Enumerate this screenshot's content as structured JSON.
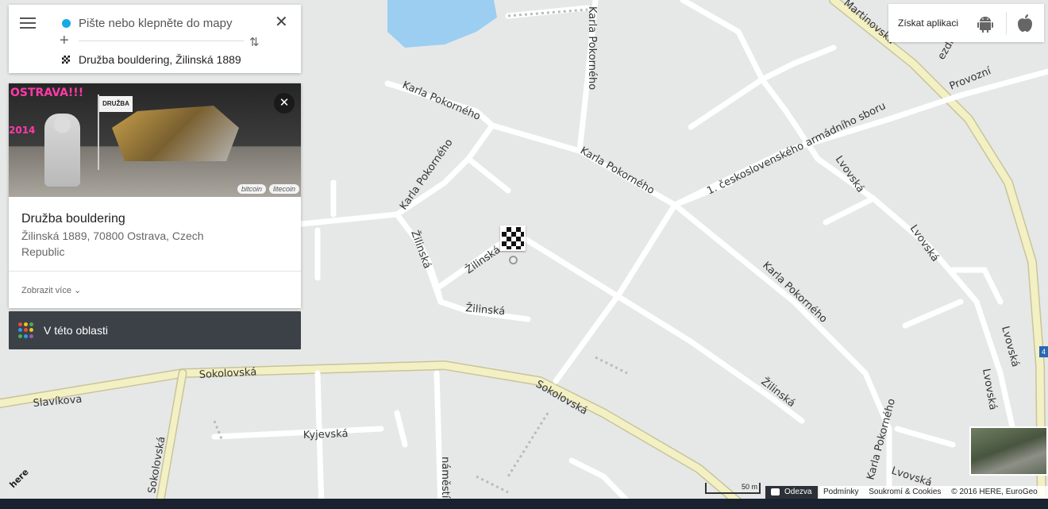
{
  "search": {
    "from_placeholder": "Pište nebo klepněte do mapy",
    "destination": "Družba bouldering, Žilinská 1889"
  },
  "place": {
    "photo_title": "OSTRAVA!!!",
    "photo_year": "2014",
    "photo_flag_text": "DRUŽBA",
    "badges": [
      "bitcoin",
      "litecoin"
    ],
    "name": "Družba bouldering",
    "address": "Žilinská 1889, 70800 Ostrava, Czech Republic",
    "show_more": "Zobrazit více"
  },
  "area_button": {
    "label": "V této oblasti",
    "dot_colors": [
      "#e84c3d",
      "#f4c21c",
      "#4caf50",
      "#2f9be0",
      "#e84c3d",
      "#f4c21c",
      "#4caf50",
      "#2f9be0",
      "#9b59b6"
    ]
  },
  "get_app": {
    "label": "Získat aplikaci",
    "icons": [
      "android-icon",
      "apple-icon"
    ]
  },
  "map": {
    "streets": {
      "karla_pokorneho": "Karla Pokorného",
      "zilinska": "Žilinská",
      "sokolovska": "Sokolovská",
      "slavikova": "Slavíkova",
      "kyjevska": "Kyjevská",
      "lvovska": "Lvovská",
      "ceskoslovenskeho": "1. československého armádního sboru",
      "martinovska": "Martinovská",
      "provozni": "Provozní",
      "namesti": "náměstí",
      "zedku": "ezdku"
    },
    "scale": "50 m",
    "edge_sign": "4"
  },
  "footer": {
    "feedback": "Odezva",
    "terms": "Podmínky",
    "privacy": "Soukromí & Cookies",
    "copyright": "© 2016 HERE, EuroGeo",
    "logo": "here"
  },
  "colors": {
    "accent": "#17a9e6",
    "dark_panel": "#3b4147",
    "map_bg": "#e6e8e7",
    "major_road": "#f3f0c4"
  }
}
